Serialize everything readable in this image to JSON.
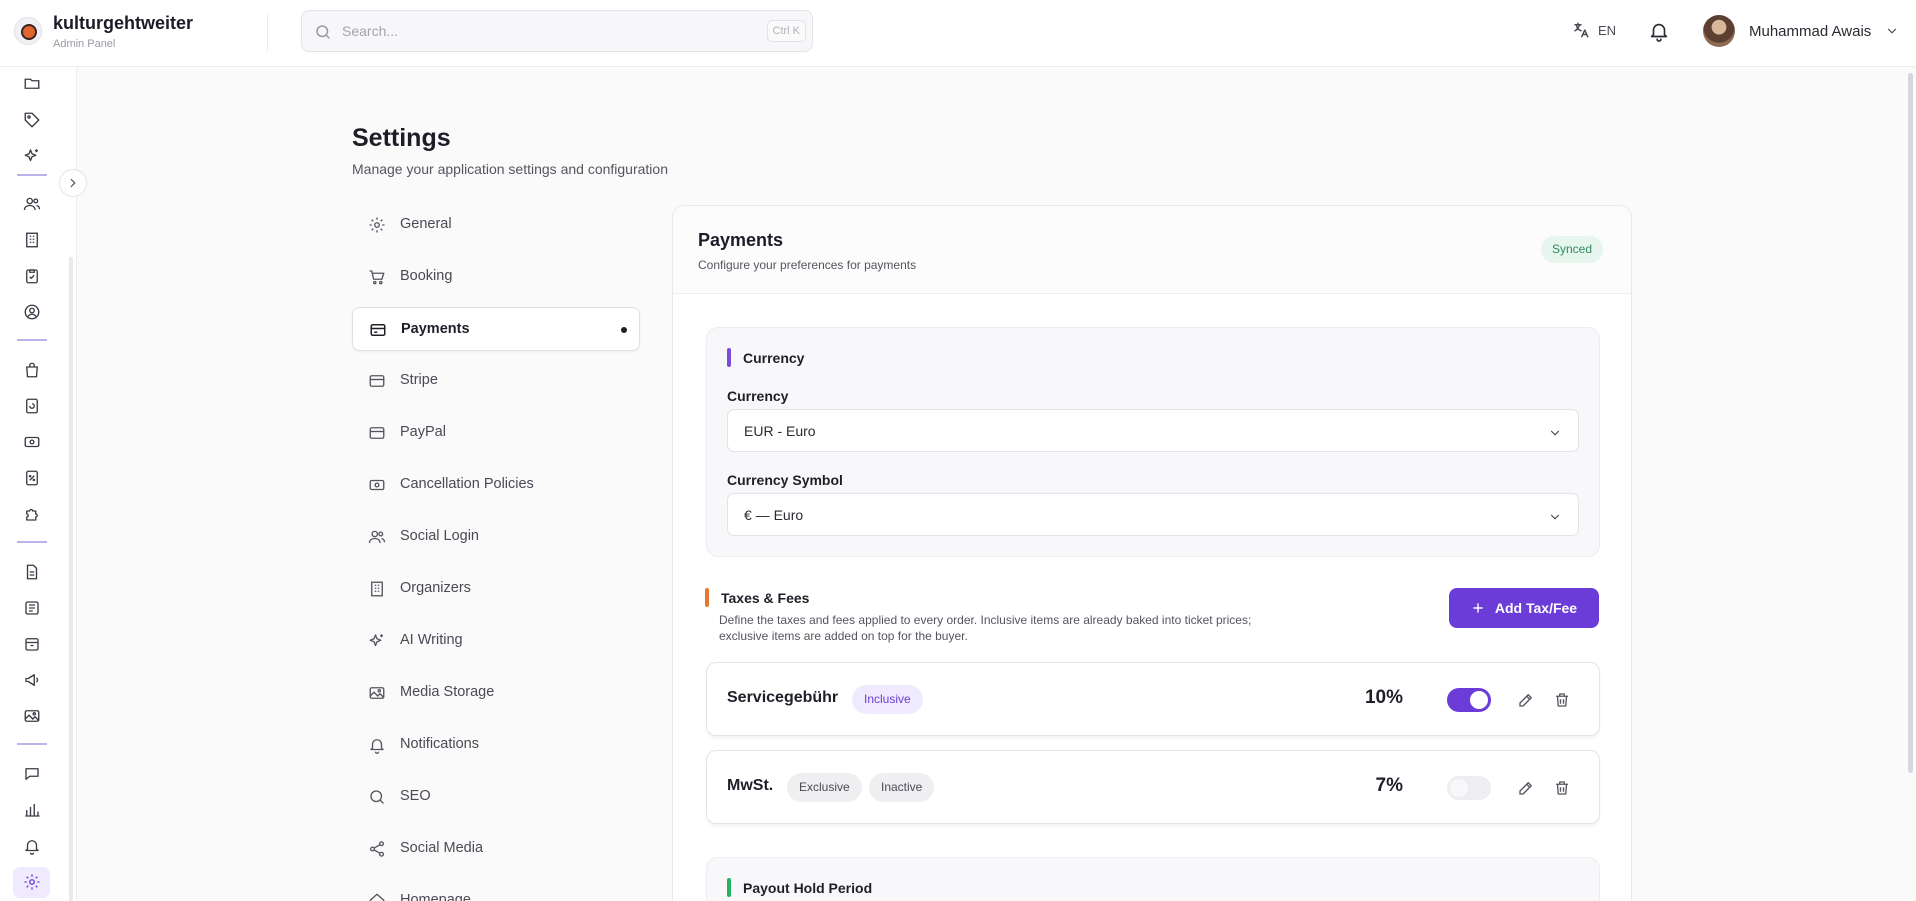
{
  "brand": {
    "name": "kulturgehtweiter",
    "subtitle": "Admin Panel"
  },
  "search": {
    "placeholder": "Search...",
    "shortcut": "Ctrl K"
  },
  "header": {
    "language": "EN",
    "user_name": "Muhammad Awais"
  },
  "page": {
    "title": "Settings",
    "subtitle": "Manage your application settings and configuration"
  },
  "nav": [
    {
      "label": "General",
      "icon": "gear-icon"
    },
    {
      "label": "Booking",
      "icon": "cart-icon"
    },
    {
      "label": "Payments",
      "icon": "card-icon",
      "active": true
    },
    {
      "label": "Stripe",
      "icon": "card-icon"
    },
    {
      "label": "PayPal",
      "icon": "card-icon"
    },
    {
      "label": "Cancellation Policies",
      "icon": "banknote-icon"
    },
    {
      "label": "Social Login",
      "icon": "users-icon"
    },
    {
      "label": "Organizers",
      "icon": "building-icon"
    },
    {
      "label": "AI Writing",
      "icon": "sparkles-icon"
    },
    {
      "label": "Media Storage",
      "icon": "image-icon"
    },
    {
      "label": "Notifications",
      "icon": "bell-icon"
    },
    {
      "label": "SEO",
      "icon": "search-icon"
    },
    {
      "label": "Social Media",
      "icon": "share-icon"
    },
    {
      "label": "Homepage",
      "icon": "home-icon"
    }
  ],
  "card": {
    "title": "Payments",
    "subtitle": "Configure your preferences for payments",
    "status": "Synced"
  },
  "currency": {
    "section_title": "Currency",
    "currency_label": "Currency",
    "currency_value": "EUR - Euro",
    "symbol_label": "Currency Symbol",
    "symbol_value": "€ — Euro"
  },
  "taxes": {
    "section_title": "Taxes & Fees",
    "description": "Define the taxes and fees applied to every order. Inclusive items are already baked into ticket prices; exclusive items are added on top for the buyer.",
    "add_label": "Add Tax/Fee",
    "items": [
      {
        "name": "Servicegebühr",
        "tags": [
          "Inclusive"
        ],
        "percent": "10%",
        "enabled": true
      },
      {
        "name": "MwSt.",
        "tags": [
          "Exclusive",
          "Inactive"
        ],
        "percent": "7%",
        "enabled": false
      }
    ]
  },
  "payout": {
    "section_title": "Payout Hold Period"
  },
  "colors": {
    "accent": "#6c3cd9",
    "currency_bar": "#7c4ddb",
    "taxes_bar": "#e8772e",
    "payout_bar": "#22b35e",
    "synced_bg": "#e6f6ee"
  }
}
